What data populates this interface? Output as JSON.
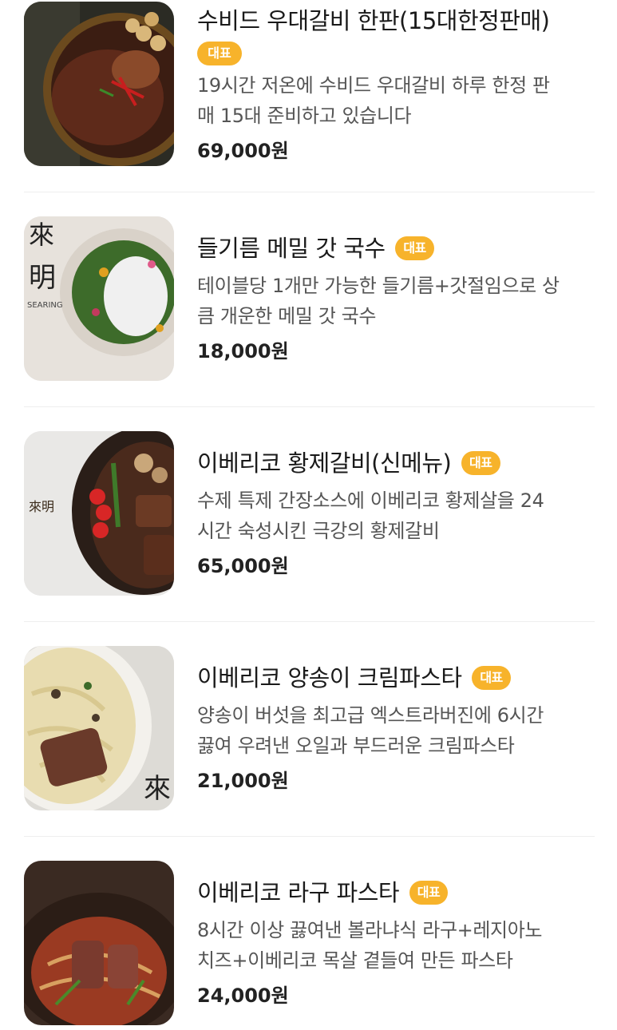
{
  "menu": {
    "items": [
      {
        "name": "수비드 우대갈비 한판(15대한정판매)",
        "badge": "대표",
        "desc_line1": "19시간 저온에 수비드 우대갈비 하루 한정 판",
        "desc_line2": "매 15대 준비하고 있습니다",
        "price": "69,000원"
      },
      {
        "name": "들기름 메밀 갓 국수",
        "badge": "대표",
        "desc_line1": "테이블당 1개만 가능한 들기름+갓절임으로 상",
        "desc_line2": "큼 개운한 메밀 갓 국수",
        "price": "18,000원"
      },
      {
        "name": "이베리코 황제갈비(신메뉴)",
        "badge": "대표",
        "desc_line1": "수제 특제 간장소스에 이베리코 황제살을 24",
        "desc_line2": "시간 숙성시킨 극강의 황제갈비",
        "price": "65,000원"
      },
      {
        "name": "이베리코 양송이 크림파스타",
        "badge": "대표",
        "desc_line1": "양송이 버섯을 최고급 엑스트라버진에 6시간",
        "desc_line2": "끓여 우려낸 오일과 부드러운 크림파스타",
        "price": "21,000원"
      },
      {
        "name": "이베리코 라구 파스타",
        "badge": "대표",
        "desc_line1": "8시간 이상 끓여낸 볼라냐식 라구+레지아노",
        "desc_line2": "치즈+이베리코 목살 곁들여 만든 파스타",
        "price": "24,000원"
      }
    ],
    "image_marks": {
      "item2_logo_char1": "來",
      "item2_logo_char2": "明",
      "item2_logo_sub": "SEARING",
      "item3_logo": "來明",
      "item4_logo": "來"
    }
  }
}
